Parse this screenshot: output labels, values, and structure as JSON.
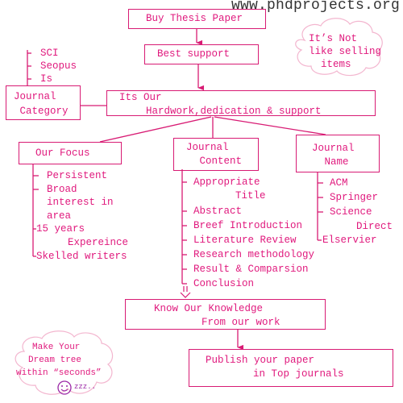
{
  "watermark": "www.phdprojects.org",
  "colors": {
    "accent": "#e0197d",
    "line": "#d81b74",
    "cloud": "#f3b6cf",
    "smiley": "#9b27a6"
  },
  "nodes": {
    "buy_thesis": {
      "label": "Buy Thesis Paper"
    },
    "best_support": {
      "label": "Best support"
    },
    "hardwork": {
      "line1": "Its Our",
      "line2": "Hardwork,dedication & support"
    },
    "journal_category": {
      "line1": "Journal",
      "line2": " Category"
    },
    "our_focus": {
      "label": "Our Focus"
    },
    "journal_content": {
      "line1": "Journal",
      "line2": " Content"
    },
    "journal_name": {
      "line1": "Journal",
      "line2": " Name"
    },
    "know_knowledge": {
      "line1": "Know Our Knowledge",
      "line2": "From our work"
    },
    "publish": {
      "line1": "Publish your paper",
      "line2": "in Top journals"
    }
  },
  "journal_category_items": [
    "SCI",
    "Seopus",
    "Is"
  ],
  "focus_items": [
    "Persistent",
    "Broad",
    "interest in",
    "area",
    "15 years",
    "Expereince",
    "Skelled writers"
  ],
  "content_items": [
    "Appropriate",
    "Title",
    "Abstract",
    "Breef Introduction",
    "Literature Review",
    "Research methodology",
    "Result & Comparsion",
    "Conclusion"
  ],
  "name_items": [
    "ACM",
    "Springer",
    "Science",
    "Direct",
    "Elservier"
  ],
  "clouds": {
    "top": {
      "line1": "It’s Not",
      "line2": "like selling",
      "line3": "items"
    },
    "bottom": {
      "line1": "Make Your",
      "line2": "Dream tree",
      "line3": "within “seconds”",
      "sleep": "zzz.."
    }
  }
}
